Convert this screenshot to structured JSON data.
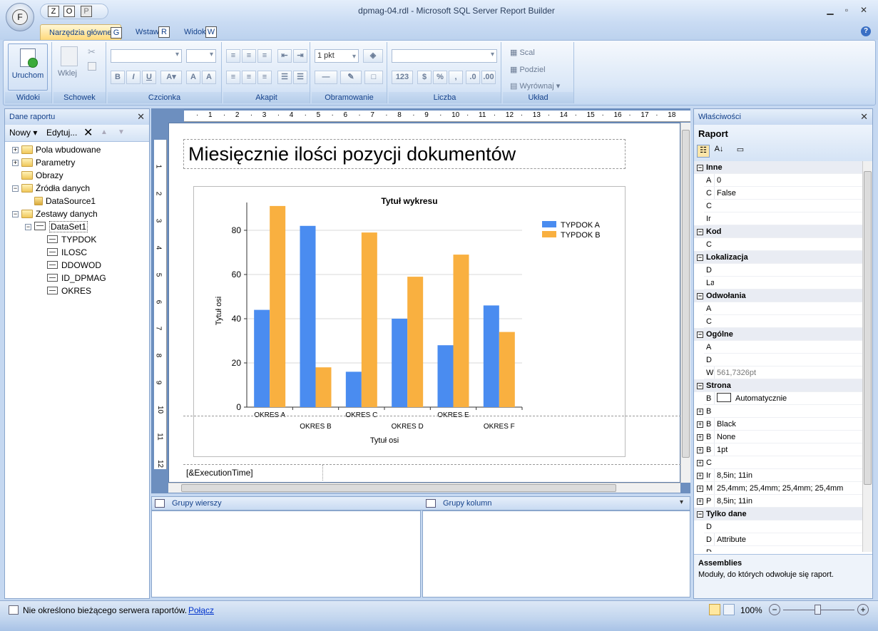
{
  "window": {
    "title": "dpmag-04.rdl - Microsoft SQL Server Report Builder",
    "app_button_key": "F",
    "qat_keys": [
      "Z",
      "O",
      "P"
    ]
  },
  "tabs": [
    {
      "label": "Narzędzia główne",
      "key": "G"
    },
    {
      "label": "Wstaw",
      "key": "R"
    },
    {
      "label": "Widok",
      "key": "W"
    }
  ],
  "ribbon": {
    "groups": {
      "views": "Widoki",
      "clipboard": "Schowek",
      "font": "Czcionka",
      "paragraph": "Akapit",
      "border": "Obramowanie",
      "number": "Liczba",
      "layout": "Układ"
    },
    "run_label": "Uruchom",
    "paste_label": "Wklej",
    "border_width": "1 pkt",
    "merge_label": "Scal",
    "split_label": "Podziel",
    "align_label": "Wyrównaj"
  },
  "report_data": {
    "title": "Dane raportu",
    "new_label": "Nowy",
    "edit_label": "Edytuj...",
    "tree": [
      {
        "label": "Pola wbudowane",
        "kind": "folder",
        "level": 0,
        "expander": "+"
      },
      {
        "label": "Parametry",
        "kind": "folder",
        "level": 0,
        "expander": "+"
      },
      {
        "label": "Obrazy",
        "kind": "folder",
        "level": 0,
        "expander": ""
      },
      {
        "label": "Źródła danych",
        "kind": "folder",
        "level": 0,
        "expander": "−"
      },
      {
        "label": "DataSource1",
        "kind": "datasource",
        "level": 1,
        "expander": ""
      },
      {
        "label": "Zestawy danych",
        "kind": "folder",
        "level": 0,
        "expander": "−"
      },
      {
        "label": "DataSet1",
        "kind": "dataset",
        "level": 1,
        "expander": "−"
      },
      {
        "label": "TYPDOK",
        "kind": "field",
        "level": 2,
        "expander": ""
      },
      {
        "label": "ILOSC",
        "kind": "field",
        "level": 2,
        "expander": ""
      },
      {
        "label": "DDOWOD",
        "kind": "field",
        "level": 2,
        "expander": ""
      },
      {
        "label": "ID_DPMAG",
        "kind": "field",
        "level": 2,
        "expander": ""
      },
      {
        "label": "OKRES",
        "kind": "field",
        "level": 2,
        "expander": ""
      }
    ]
  },
  "ruler_numbers": [
    "1",
    "2",
    "3",
    "4",
    "5",
    "6",
    "7",
    "8",
    "9",
    "10",
    "11",
    "12",
    "13",
    "14",
    "15",
    "16",
    "17",
    "18"
  ],
  "report": {
    "title": "Miesięcznie ilości pozycji dokumentów",
    "footer_expression": "[&ExecutionTime]"
  },
  "chart_data": {
    "type": "bar",
    "title": "Tytuł wykresu",
    "xlabel": "Tytuł osi",
    "ylabel": "Tytuł osi",
    "categories": [
      "OKRES A",
      "OKRES B",
      "OKRES C",
      "OKRES D",
      "OKRES E",
      "OKRES F"
    ],
    "series": [
      {
        "name": "TYPDOK A",
        "color": "#4a8cf0",
        "values": [
          44,
          82,
          16,
          40,
          28,
          46
        ]
      },
      {
        "name": "TYPDOK B",
        "color": "#f9b040",
        "values": [
          91,
          18,
          79,
          59,
          69,
          34
        ]
      }
    ],
    "ylim": [
      0,
      90
    ],
    "yticks": [
      0,
      20,
      40,
      60,
      80
    ],
    "grid": true,
    "legend": "top-right"
  },
  "groups": {
    "rows_label": "Grupy wierszy",
    "columns_label": "Grupy kolumn"
  },
  "properties": {
    "title": "Właściwości",
    "object": "Raport",
    "rows": [
      {
        "type": "cat",
        "name": "Inne"
      },
      {
        "type": "prop",
        "name": "A",
        "value": "0"
      },
      {
        "type": "prop",
        "name": "C",
        "value": "False"
      },
      {
        "type": "prop",
        "name": "C",
        "value": ""
      },
      {
        "type": "prop",
        "name": "Ir",
        "value": ""
      },
      {
        "type": "cat",
        "name": "Kod"
      },
      {
        "type": "prop",
        "name": "C",
        "value": ""
      },
      {
        "type": "cat",
        "name": "Lokalizacja"
      },
      {
        "type": "prop",
        "name": "D",
        "value": ""
      },
      {
        "type": "prop",
        "name": "La",
        "value": ""
      },
      {
        "type": "cat",
        "name": "Odwołania"
      },
      {
        "type": "prop",
        "name": "A",
        "value": ""
      },
      {
        "type": "prop",
        "name": "C",
        "value": ""
      },
      {
        "type": "cat",
        "name": "Ogólne"
      },
      {
        "type": "prop",
        "name": "A",
        "value": ""
      },
      {
        "type": "prop",
        "name": "D",
        "value": ""
      },
      {
        "type": "prop",
        "name": "W",
        "value": "561,7326pt",
        "muted": true
      },
      {
        "type": "cat",
        "name": "Strona"
      },
      {
        "type": "prop",
        "name": "B",
        "value": "Automatycznie",
        "swatch": true
      },
      {
        "type": "prop",
        "name": "B",
        "value": "",
        "expand": true
      },
      {
        "type": "prop",
        "name": "B",
        "value": "Black",
        "expand": true
      },
      {
        "type": "prop",
        "name": "B",
        "value": "None",
        "expand": true
      },
      {
        "type": "prop",
        "name": "B",
        "value": "1pt",
        "expand": true
      },
      {
        "type": "prop",
        "name": "C",
        "value": "",
        "expand": true
      },
      {
        "type": "prop",
        "name": "Ir",
        "value": "8,5in; 11in",
        "expand": true
      },
      {
        "type": "prop",
        "name": "M",
        "value": "25,4mm; 25,4mm; 25,4mm; 25,4mm",
        "expand": true
      },
      {
        "type": "prop",
        "name": "P",
        "value": "8,5in; 11in",
        "expand": true
      },
      {
        "type": "cat",
        "name": "Tylko dane"
      },
      {
        "type": "prop",
        "name": "D",
        "value": ""
      },
      {
        "type": "prop",
        "name": "D",
        "value": "Attribute"
      },
      {
        "type": "prop",
        "name": "D",
        "value": ""
      }
    ],
    "help_title": "Assemblies",
    "help_text": "Moduły, do których odwołuje się raport."
  },
  "status": {
    "message": "Nie określono bieżącego serwera raportów.",
    "link": "Połącz",
    "zoom": "100%"
  }
}
